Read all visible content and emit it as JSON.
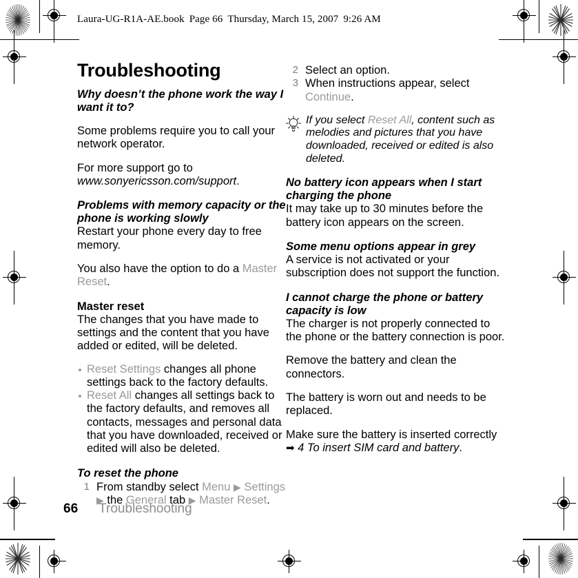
{
  "header": {
    "slug_file": "Laura-UG-R1A-AE.book",
    "slug_page": "Page 66",
    "slug_date": "Thursday, March 15, 2007",
    "slug_time": "9:26 AM"
  },
  "colors": {
    "ui_reference": "#9a9a9a",
    "body_text": "#000000",
    "footer_chapter": "#8d8d8d"
  },
  "left_column": {
    "title": "Troubleshooting",
    "q1": "Why doesn’t the phone work the way I want it to?",
    "p1": "Some problems require you to call your network operator.",
    "p2_prefix": "For more support go to ",
    "p2_url": "www.sonyericsson.com/support",
    "p2_suffix": ".",
    "h_memory": "Problems with memory capacity or the phone is working slowly",
    "p3": "Restart your phone every day to free memory.",
    "p4_prefix": "You also have the option to do a ",
    "p4_ui": "Master Reset",
    "p4_suffix": ".",
    "h_master_reset": "Master reset",
    "p5": "The changes that you have made to settings and the content that you have added or edited, will be deleted.",
    "bullets": [
      {
        "ui": "Reset Settings",
        "rest": " changes all phone settings back to the factory defaults."
      },
      {
        "ui": "Reset All",
        "rest": " changes all settings back to the factory defaults, and removes all contacts, messages and personal data that you have downloaded, received or edited will also be deleted."
      }
    ],
    "h_to_reset": "To reset the phone",
    "step1": {
      "num": "1",
      "t1": "From standby select ",
      "ui1": "Menu",
      "arrow1": "▶",
      "ui2": "Settings",
      "arrow2": "▶",
      "t2": " the ",
      "ui3": "General",
      "t3": " tab ",
      "arrow3": "▶",
      "ui4": "Master Reset",
      "t4": "."
    }
  },
  "right_column": {
    "step2": {
      "num": "2",
      "text": "Select an option."
    },
    "step3": {
      "num": "3",
      "t1": "When instructions appear, select ",
      "ui": "Continue",
      "t2": "."
    },
    "tip": {
      "icon": "lightbulb-icon",
      "t1": "If you select ",
      "ui": "Reset All",
      "t2": ", content such as melodies and pictures that you have downloaded, received or edited is also deleted."
    },
    "h_battery_icon": "No battery icon appears when I start charging the phone",
    "p_battery_icon": "It may take up to 30 minutes before the battery icon appears on the screen.",
    "h_grey_menu": "Some menu options appear in grey",
    "p_grey_menu": "A service is not activated or your subscription does not support the function.",
    "h_charge": "I cannot charge the phone or battery capacity is low",
    "p_charge1": "The charger is not properly connected to the phone or the battery connection is poor.",
    "p_charge2": "Remove the battery and clean the connectors.",
    "p_charge3": "The battery is worn out and needs to be replaced.",
    "p_charge4_t1": "Make sure the battery is inserted correctly ",
    "p_charge4_arrow": "➡",
    "p_charge4_ref": "4 To insert SIM card and battery",
    "p_charge4_t2": "."
  },
  "footer": {
    "page_number": "66",
    "chapter": "Troubleshooting"
  }
}
